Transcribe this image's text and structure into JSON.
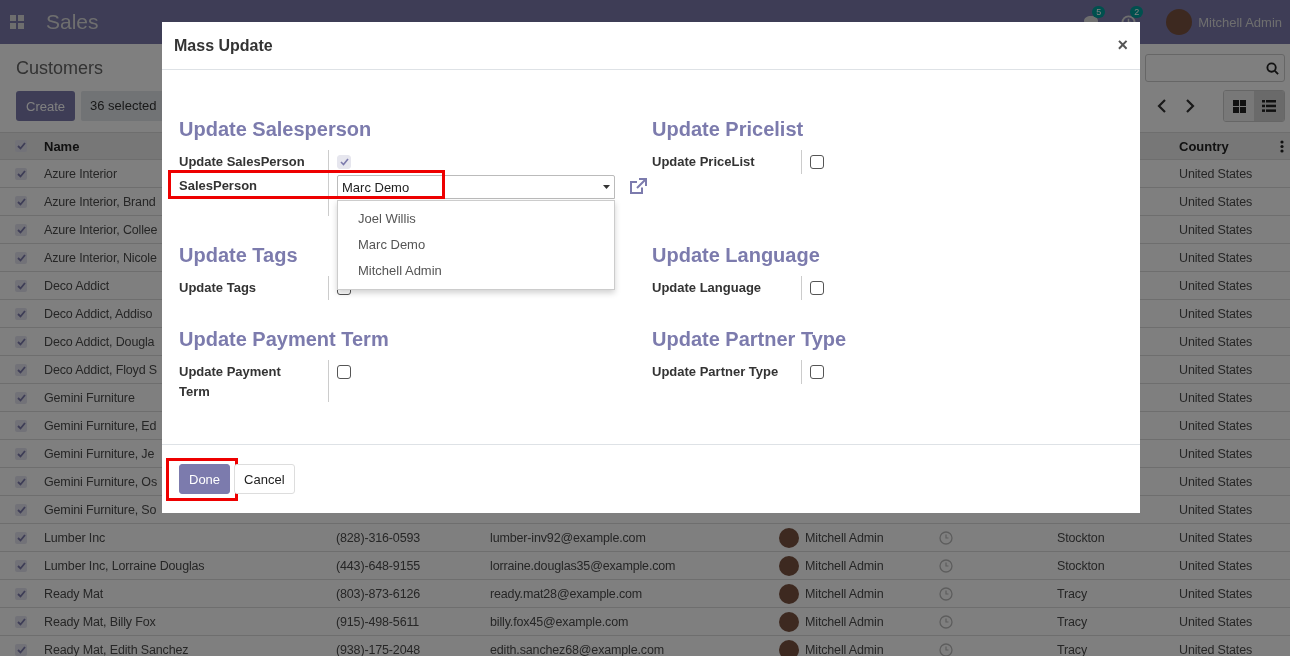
{
  "navbar": {
    "app": "Sales",
    "messages_badge": "5",
    "activities_badge": "2",
    "user": "Mitchell Admin"
  },
  "control_panel": {
    "title": "Customers",
    "create_button": "Create",
    "selection": "36 selected",
    "views": [
      {
        "kind": "kanban",
        "selected": false
      },
      {
        "kind": "list",
        "selected": true
      }
    ]
  },
  "table": {
    "header": {
      "checked": true,
      "name": "Name",
      "country": "Country"
    },
    "rows": [
      {
        "checked": true,
        "name": "Azure Interior",
        "country": "United States"
      },
      {
        "checked": true,
        "name": "Azure Interior, Brand",
        "country": "United States"
      },
      {
        "checked": true,
        "name": "Azure Interior, Collee",
        "country": "United States"
      },
      {
        "checked": true,
        "name": "Azure Interior, Nicole",
        "country": "United States"
      },
      {
        "checked": true,
        "name": "Deco Addict",
        "country": "United States"
      },
      {
        "checked": true,
        "name": "Deco Addict, Addiso",
        "country": "United States"
      },
      {
        "checked": true,
        "name": "Deco Addict, Dougla",
        "country": "United States"
      },
      {
        "checked": true,
        "name": "Deco Addict, Floyd S",
        "country": "United States"
      },
      {
        "checked": true,
        "name": "Gemini Furniture",
        "country": "United States"
      },
      {
        "checked": true,
        "name": "Gemini Furniture, Ed",
        "country": "United States"
      },
      {
        "checked": true,
        "name": "Gemini Furniture, Je",
        "country": "United States"
      },
      {
        "checked": true,
        "name": "Gemini Furniture, Os",
        "country": "United States"
      },
      {
        "checked": true,
        "name": "Gemini Furniture, So",
        "country": "United States"
      },
      {
        "checked": true,
        "name": "Lumber Inc",
        "phone": "(828)-316-0593",
        "email": "lumber-inv92@example.com",
        "salesperson": "Mitchell Admin",
        "city": "Stockton",
        "country": "United States"
      },
      {
        "checked": true,
        "name": "Lumber Inc, Lorraine Douglas",
        "phone": "(443)-648-9155",
        "email": "lorraine.douglas35@example.com",
        "salesperson": "Mitchell Admin",
        "city": "Stockton",
        "country": "United States"
      },
      {
        "checked": true,
        "name": "Ready Mat",
        "phone": "(803)-873-6126",
        "email": "ready.mat28@example.com",
        "salesperson": "Mitchell Admin",
        "city": "Tracy",
        "country": "United States"
      },
      {
        "checked": true,
        "name": "Ready Mat, Billy Fox",
        "phone": "(915)-498-5611",
        "email": "billy.fox45@example.com",
        "salesperson": "Mitchell Admin",
        "city": "Tracy",
        "country": "United States"
      },
      {
        "checked": true,
        "name": "Ready Mat, Edith Sanchez",
        "phone": "(938)-175-2048",
        "email": "edith.sanchez68@example.com",
        "salesperson": "Mitchell Admin",
        "city": "Tracy",
        "country": "United States"
      }
    ]
  },
  "dialog": {
    "title": "Mass Update",
    "close": "×",
    "section_rows": [
      [
        {
          "title": "Update Salesperson",
          "fields": [
            {
              "kind": "checkbox",
              "label": "Update SalesPerson",
              "checked": true,
              "disabled": true
            },
            {
              "kind": "select",
              "label": "SalesPerson",
              "value": "Marc Demo",
              "highlighted": true,
              "expanded": true,
              "options": [
                "Joel Willis",
                "Marc Demo",
                "Mitchell Admin"
              ]
            }
          ]
        },
        {
          "title": "Update Pricelist",
          "fields": [
            {
              "kind": "checkbox",
              "label": "Update PriceList",
              "checked": false,
              "disabled": false
            }
          ]
        }
      ],
      [
        {
          "title": "Update Tags",
          "fields": [
            {
              "kind": "checkbox",
              "label": "Update Tags",
              "checked": false,
              "disabled": false
            }
          ]
        },
        {
          "title": "Update Language",
          "fields": [
            {
              "kind": "checkbox",
              "label": "Update Language",
              "checked": false,
              "disabled": false
            }
          ]
        }
      ],
      [
        {
          "title": "Update Payment Term",
          "fields": [
            {
              "kind": "checkbox",
              "label": "Update Payment Term",
              "checked": false,
              "disabled": false
            }
          ]
        },
        {
          "title": "Update Partner Type",
          "fields": [
            {
              "kind": "checkbox",
              "label": "Update Partner Type",
              "checked": false,
              "disabled": false
            }
          ]
        }
      ]
    ],
    "buttons": [
      {
        "kind": "primary",
        "label": "Done",
        "highlighted": true
      },
      {
        "kind": "secondary",
        "label": "Cancel",
        "highlighted": false
      }
    ]
  }
}
